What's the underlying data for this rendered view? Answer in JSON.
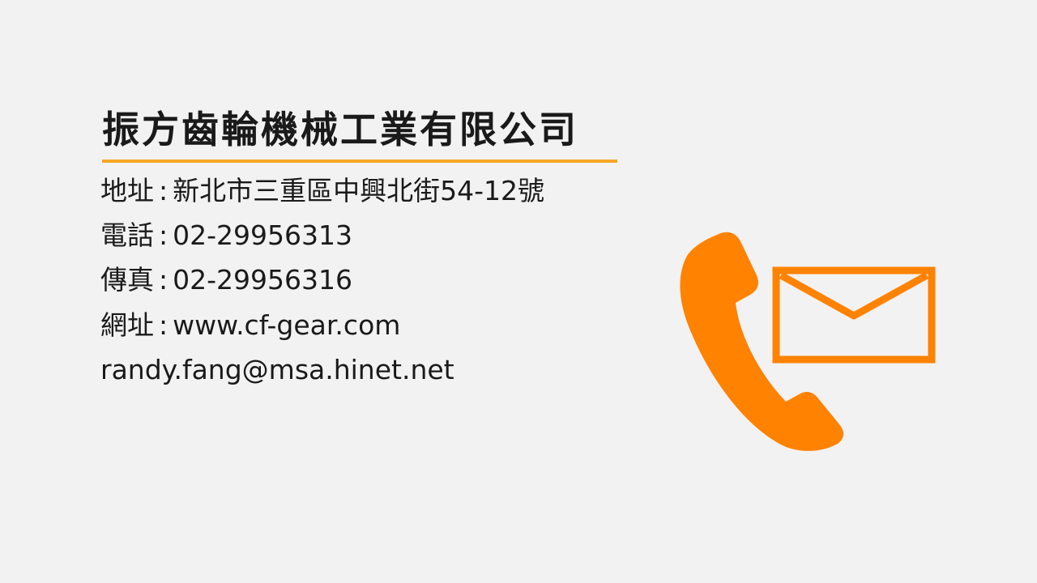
{
  "company": {
    "name": "振方齒輪機械工業有限公司"
  },
  "contact": {
    "separator": ":",
    "address_label": "地址",
    "address_value": "新北市三重區中興北街54-12號",
    "phone_label": "電話",
    "phone_value": "02-29956313",
    "fax_label": "傳真",
    "fax_value": "02-29956316",
    "web_label": "網址",
    "web_value": "www.cf-gear.com",
    "email_value": "randy.fang@msa.hinet.net"
  },
  "icons": {
    "phone": "phone-handset-icon",
    "mail": "envelope-icon",
    "accent_color": "#ff8200"
  },
  "colors": {
    "background": "#f2f2f2",
    "underline": "#f5a623",
    "text": "#1a1a1a"
  }
}
